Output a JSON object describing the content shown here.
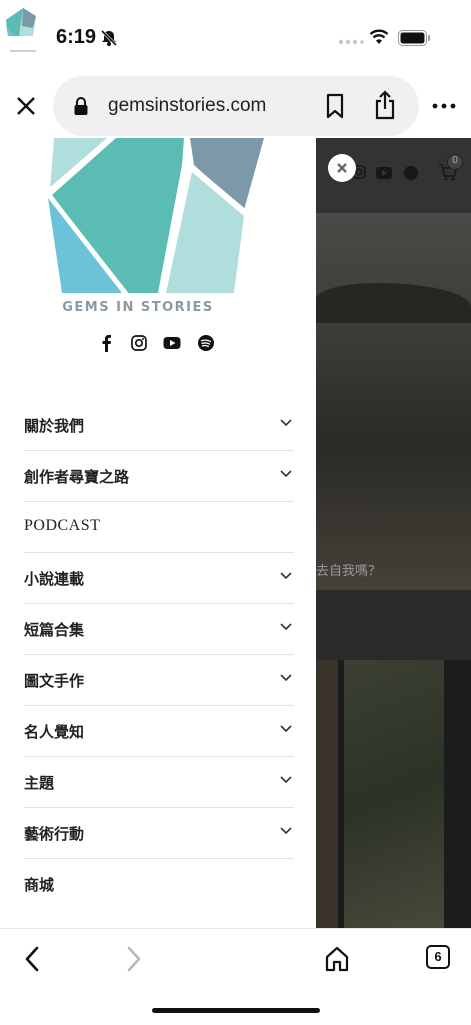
{
  "status_bar": {
    "time": "6:19",
    "icons": [
      "gem-logo-icon",
      "bell-muted-icon",
      "signal-dots-icon",
      "wifi-icon",
      "battery-icon"
    ]
  },
  "browser": {
    "url": "gemsinstories.com",
    "icons": [
      "close-icon",
      "lock-icon",
      "bookmark-icon",
      "share-icon",
      "more-icon"
    ]
  },
  "drawer": {
    "brand_name": "GEMS IN STORIES",
    "social_icons": [
      "facebook-icon",
      "instagram-icon",
      "youtube-icon",
      "spotify-icon"
    ],
    "menu": [
      {
        "label": "關於我們",
        "has_submenu": true
      },
      {
        "label": "創作者尋寶之路",
        "has_submenu": true
      },
      {
        "label": "PODCAST",
        "has_submenu": false
      },
      {
        "label": "小說連載",
        "has_submenu": true
      },
      {
        "label": "短篇合集",
        "has_submenu": true
      },
      {
        "label": "圖文手作",
        "has_submenu": true
      },
      {
        "label": "名人覺知",
        "has_submenu": true
      },
      {
        "label": "主題",
        "has_submenu": true
      },
      {
        "label": "藝術行動",
        "has_submenu": true
      },
      {
        "label": "商城",
        "has_submenu": false
      }
    ]
  },
  "background_page": {
    "caption_fragment": "去自我嗎？",
    "cart_count": "0",
    "icons": [
      "instagram-icon",
      "youtube-icon",
      "spotify-icon",
      "cart-icon",
      "close-icon"
    ]
  },
  "bottom_toolbar": {
    "tab_count": "6",
    "icons": [
      "back-icon",
      "forward-icon",
      "home-icon",
      "tabs-icon"
    ]
  },
  "colors": {
    "logo_teal": "#5bbcb4",
    "logo_light": "#b0dedd",
    "logo_blue": "#6cc2d8",
    "logo_slate": "#7b99a8",
    "brand_text": "#8a9aa3"
  }
}
